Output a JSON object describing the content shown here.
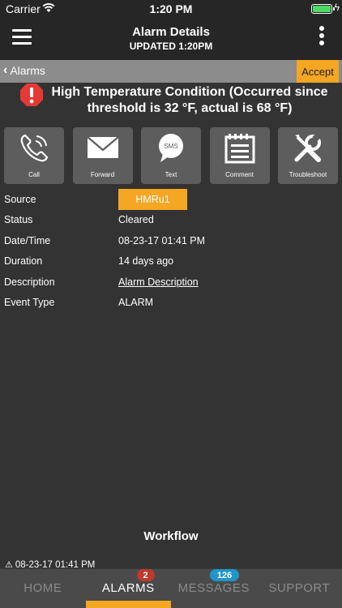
{
  "status_bar": {
    "carrier": "Carrier",
    "time": "1:20 PM",
    "battery_level": 1.0
  },
  "header": {
    "title": "Alarm Details",
    "subtitle": "UPDATED 1:20PM"
  },
  "sub_header": {
    "back_label": "Alarms",
    "accept_label": "Accept"
  },
  "alarm": {
    "title": "High Temperature Condition (Occurred since threshold is 32 °F, actual is 68 °F)",
    "icon": "exclamation-octagon-icon",
    "icon_color": "#e53935"
  },
  "actions": [
    {
      "label": "Call",
      "icon": "phone-icon"
    },
    {
      "label": "Forward",
      "icon": "envelope-icon"
    },
    {
      "label": "Text",
      "icon": "sms-bubble-icon",
      "icon_text": "SMS"
    },
    {
      "label": "Comment",
      "icon": "notepad-icon"
    },
    {
      "label": "Troubleshoot",
      "icon": "tools-icon"
    }
  ],
  "details": {
    "source_label": "Source",
    "source_value": "HMRu1",
    "status_label": "Status",
    "status_value": "Cleared",
    "datetime_label": "Date/Time",
    "datetime_value": "08-23-17 01:41 PM",
    "duration_label": "Duration",
    "duration_value": "14 days ago",
    "description_label": "Description",
    "description_value": "Alarm Description",
    "event_type_label": "Event Type",
    "event_type_value": "ALARM"
  },
  "workflow": {
    "title": "Workflow",
    "entry": "08-23-17 01:41 PM"
  },
  "tabs": [
    {
      "label": "HOME",
      "badge": ""
    },
    {
      "label": "ALARMS",
      "badge": "2"
    },
    {
      "label": "MESSAGES",
      "badge": "126"
    },
    {
      "label": "SUPPORT",
      "badge": ""
    }
  ],
  "colors": {
    "accent": "#f5a623",
    "background": "#333333",
    "badge_red": "#c0392b",
    "badge_blue": "#1e96c8"
  }
}
